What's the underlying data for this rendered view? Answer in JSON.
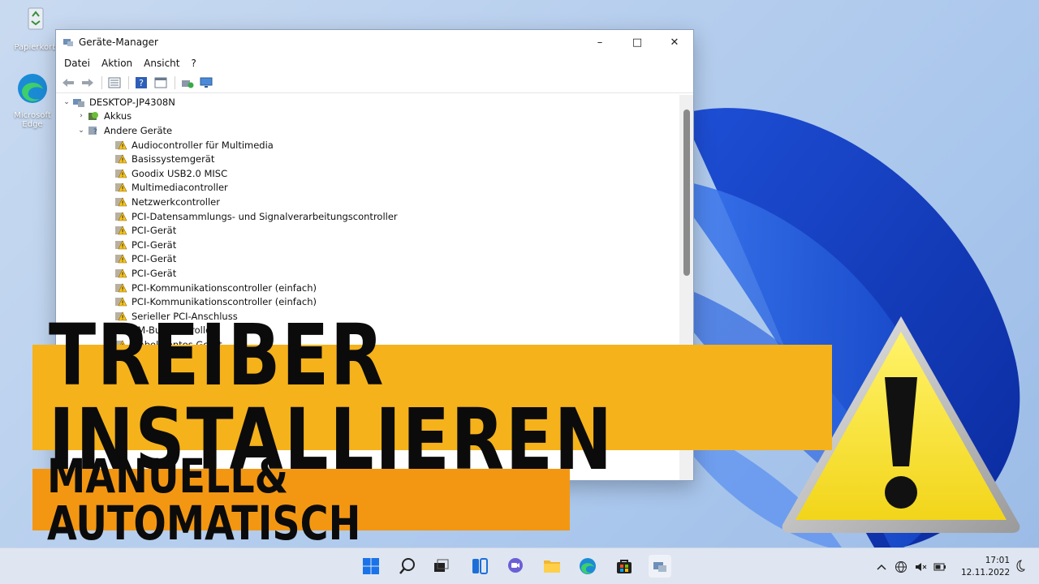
{
  "desktop": {
    "icons": [
      {
        "label": "Papierkorb"
      },
      {
        "label": "Microsoft Edge"
      }
    ]
  },
  "window": {
    "title": "Geräte-Manager",
    "controls": {
      "minimize": "–",
      "maximize": "□",
      "close": "✕"
    },
    "menu": [
      "Datei",
      "Aktion",
      "Ansicht",
      "?"
    ],
    "tree": {
      "root": "DESKTOP-JP4308N",
      "category_collapsed": "Akkus",
      "category_expanded": "Andere Geräte",
      "devices": [
        "Audiocontroller für Multimedia",
        "Basissystemgerät",
        "Goodix USB2.0 MISC",
        "Multimediacontroller",
        "Netzwerkcontroller",
        "PCI-Datensammlungs- und Signalverarbeitungscontroller",
        "PCI-Gerät",
        "PCI-Gerät",
        "PCI-Gerät",
        "PCI-Gerät",
        "PCI-Kommunikationscontroller (einfach)",
        "PCI-Kommunikationscontroller (einfach)",
        "Serieller PCI-Anschluss",
        "SM-Bus-Controller"
      ],
      "partial_bottom": "Unbekanntes Gerät"
    }
  },
  "overlay": {
    "headline": "TREIBER INSTALLIEREN",
    "subline": "MANUELL& AUTOMATISCH",
    "headline_bg": "#f5b21a",
    "subline_bg": "#f39712"
  },
  "taskbar": {
    "time": "17:01",
    "date": "12.11.2022",
    "apps": [
      "windows-start-icon",
      "search-icon",
      "task-view-icon",
      "widgets-icon",
      "chat-icon",
      "file-explorer-icon",
      "edge-icon",
      "store-icon",
      "device-manager-icon"
    ]
  }
}
